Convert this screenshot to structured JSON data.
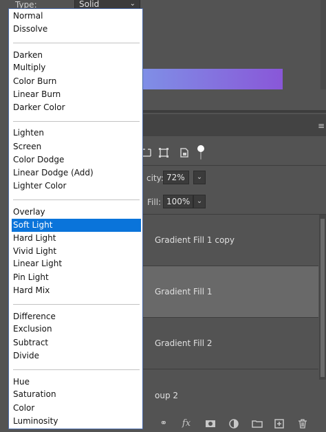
{
  "properties": {
    "type_label": "Type:",
    "type_value": "Solid",
    "gradient_colors": [
      "#7f8fe6",
      "#8957d8"
    ]
  },
  "layers_panel": {
    "opacity_label": "city:",
    "opacity_value": "72%",
    "fill_label": "Fill:",
    "fill_value": "100%",
    "layers": [
      {
        "name": "Gradient Fill 1 copy",
        "selected": false
      },
      {
        "name": "Gradient Fill 1",
        "selected": true
      },
      {
        "name": "Gradient Fill 2",
        "selected": false
      },
      {
        "name": "oup 2",
        "selected": false
      }
    ]
  },
  "blend_menu": {
    "selected": "Soft Light",
    "accent": "#0a74da",
    "groups": [
      [
        "Normal",
        "Dissolve"
      ],
      [
        "Darken",
        "Multiply",
        "Color Burn",
        "Linear Burn",
        "Darker Color"
      ],
      [
        "Lighten",
        "Screen",
        "Color Dodge",
        "Linear Dodge (Add)",
        "Lighter Color"
      ],
      [
        "Overlay",
        "Soft Light",
        "Hard Light",
        "Vivid Light",
        "Linear Light",
        "Pin Light",
        "Hard Mix"
      ],
      [
        "Difference",
        "Exclusion",
        "Subtract",
        "Divide"
      ],
      [
        "Hue",
        "Saturation",
        "Color",
        "Luminosity"
      ]
    ]
  },
  "icons": {
    "filter_row": [
      "transform-icon",
      "artboard-icon",
      "lock-icon"
    ],
    "footer": [
      "link-icon",
      "fx-icon",
      "mask-icon",
      "adjustment-icon",
      "folder-icon",
      "new-layer-icon",
      "trash-icon"
    ]
  }
}
